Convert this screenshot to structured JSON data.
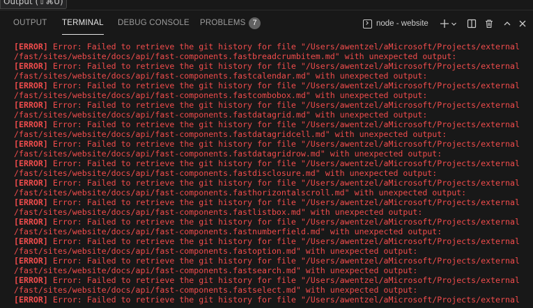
{
  "tooltip": {
    "text": "Output (⇧⌘U)"
  },
  "tabs": [
    {
      "label": "OUTPUT",
      "active": false
    },
    {
      "label": "TERMINAL",
      "active": true
    },
    {
      "label": "DEBUG CONSOLE",
      "active": false
    },
    {
      "label": "PROBLEMS",
      "active": false,
      "badge": "7"
    }
  ],
  "terminal_picker": {
    "label": "node - website",
    "icon": "terminal-icon"
  },
  "toolbar_icons": [
    "add-icon",
    "chevron-down-icon",
    "split-icon",
    "trash-icon",
    "chevron-up-icon",
    "close-icon"
  ],
  "colors": {
    "background": "#181818",
    "error_text": "#f14c4c",
    "tab_active": "#e7e7e7",
    "tab_inactive": "#9d9d9d"
  },
  "output": {
    "lines": [
      {
        "tag": "[ERROR]",
        "text": " Error: Failed to retrieve the git history for file \"/Users/awentzel/aMicrosoft/Projects/external"
      },
      {
        "tag": "",
        "text": "/fast/sites/website/docs/api/fast-components.fastbreadcrumbitem.md\" with unexpected output:"
      },
      {
        "tag": "[ERROR]",
        "text": " Error: Failed to retrieve the git history for file \"/Users/awentzel/aMicrosoft/Projects/external"
      },
      {
        "tag": "",
        "text": "/fast/sites/website/docs/api/fast-components.fastcalendar.md\" with unexpected output:"
      },
      {
        "tag": "[ERROR]",
        "text": " Error: Failed to retrieve the git history for file \"/Users/awentzel/aMicrosoft/Projects/external"
      },
      {
        "tag": "",
        "text": "/fast/sites/website/docs/api/fast-components.fastcombobox.md\" with unexpected output:"
      },
      {
        "tag": "[ERROR]",
        "text": " Error: Failed to retrieve the git history for file \"/Users/awentzel/aMicrosoft/Projects/external"
      },
      {
        "tag": "",
        "text": "/fast/sites/website/docs/api/fast-components.fastdatagrid.md\" with unexpected output:"
      },
      {
        "tag": "[ERROR]",
        "text": " Error: Failed to retrieve the git history for file \"/Users/awentzel/aMicrosoft/Projects/external"
      },
      {
        "tag": "",
        "text": "/fast/sites/website/docs/api/fast-components.fastdatagridcell.md\" with unexpected output:"
      },
      {
        "tag": "[ERROR]",
        "text": " Error: Failed to retrieve the git history for file \"/Users/awentzel/aMicrosoft/Projects/external"
      },
      {
        "tag": "",
        "text": "/fast/sites/website/docs/api/fast-components.fastdatagridrow.md\" with unexpected output:"
      },
      {
        "tag": "[ERROR]",
        "text": " Error: Failed to retrieve the git history for file \"/Users/awentzel/aMicrosoft/Projects/external"
      },
      {
        "tag": "",
        "text": "/fast/sites/website/docs/api/fast-components.fastdisclosure.md\" with unexpected output:"
      },
      {
        "tag": "[ERROR]",
        "text": " Error: Failed to retrieve the git history for file \"/Users/awentzel/aMicrosoft/Projects/external"
      },
      {
        "tag": "",
        "text": "/fast/sites/website/docs/api/fast-components.fasthorizontalscroll.md\" with unexpected output:"
      },
      {
        "tag": "[ERROR]",
        "text": " Error: Failed to retrieve the git history for file \"/Users/awentzel/aMicrosoft/Projects/external"
      },
      {
        "tag": "",
        "text": "/fast/sites/website/docs/api/fast-components.fastlistbox.md\" with unexpected output:"
      },
      {
        "tag": "[ERROR]",
        "text": " Error: Failed to retrieve the git history for file \"/Users/awentzel/aMicrosoft/Projects/external"
      },
      {
        "tag": "",
        "text": "/fast/sites/website/docs/api/fast-components.fastnumberfield.md\" with unexpected output:"
      },
      {
        "tag": "[ERROR]",
        "text": " Error: Failed to retrieve the git history for file \"/Users/awentzel/aMicrosoft/Projects/external"
      },
      {
        "tag": "",
        "text": "/fast/sites/website/docs/api/fast-components.fastoption.md\" with unexpected output:"
      },
      {
        "tag": "[ERROR]",
        "text": " Error: Failed to retrieve the git history for file \"/Users/awentzel/aMicrosoft/Projects/external"
      },
      {
        "tag": "",
        "text": "/fast/sites/website/docs/api/fast-components.fastsearch.md\" with unexpected output:"
      },
      {
        "tag": "[ERROR]",
        "text": " Error: Failed to retrieve the git history for file \"/Users/awentzel/aMicrosoft/Projects/external"
      },
      {
        "tag": "",
        "text": "/fast/sites/website/docs/api/fast-components.fastselect.md\" with unexpected output:"
      },
      {
        "tag": "[ERROR]",
        "text": " Error: Failed to retrieve the git history for file \"/Users/awentzel/aMicrosoft/Projects/external"
      }
    ]
  }
}
